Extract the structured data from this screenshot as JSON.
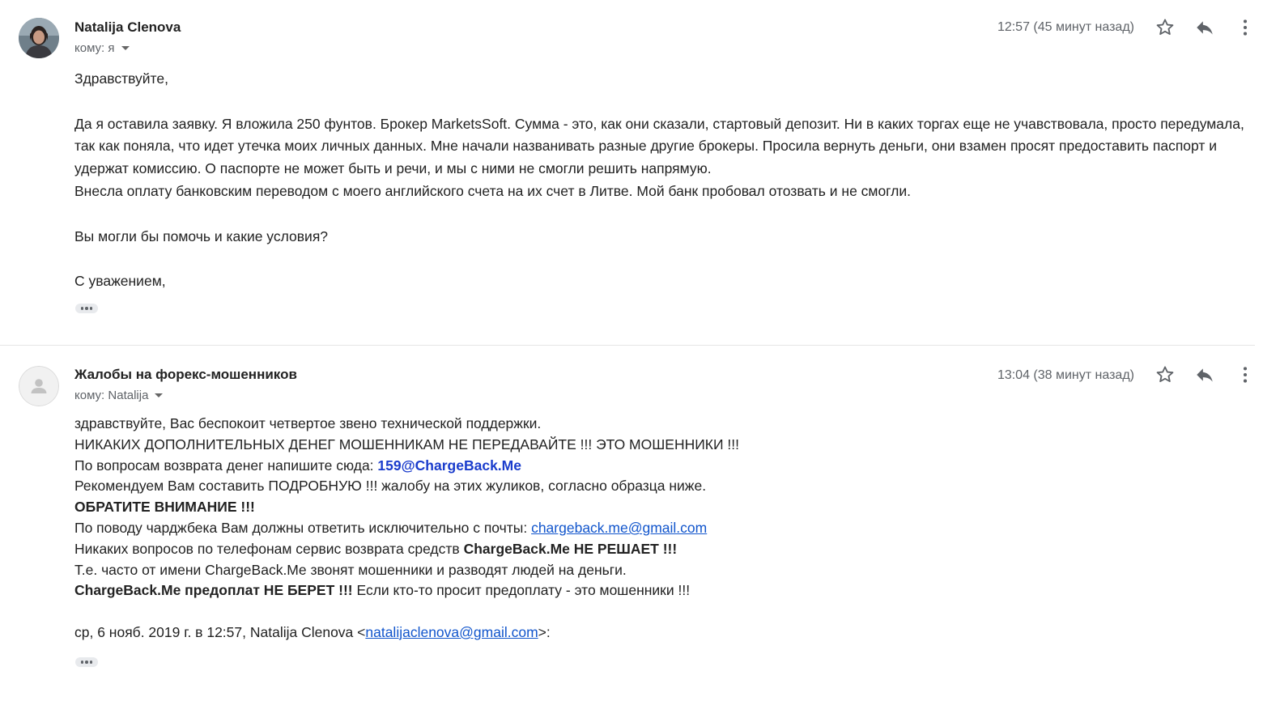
{
  "messages": [
    {
      "sender": "Natalija Clenova",
      "recipient": "кому: я",
      "time": "12:57 (45 минут назад)",
      "icons": {
        "star": "star-outline-icon",
        "reply": "reply-icon",
        "more": "more-vert-icon"
      },
      "body": {
        "greeting": "Здравствуйте,",
        "p1_l1": "Да я оставила заявку. Я вложила 250 фунтов. Брокер MarketsSoft. Сумма - это, как они сказали, стартовый депозит. Ни в каких торгах еще не учавствовала, просто передумала, так как поняла, что идет утечка моих личных данных. Мне начали названивать разные другие брокеры. Просила вернуть деньги, они взамен просят предоставить паспорт и удержат комиссию. О паспорте не может быть и речи, и мы с ними не смогли решить напрямую.",
        "p1_l2": "Внесла оплату банковским переводом с моего английского счета на их счет в Литве. Мой банк пробовал отозвать и не смогли.",
        "question": "Вы могли бы помочь и какие условия?",
        "closing": "С уважением,"
      }
    },
    {
      "sender": "Жалобы на форекс-мошенников",
      "recipient": "кому: Natalija",
      "time": "13:04 (38 минут назад)",
      "icons": {
        "star": "star-outline-icon",
        "reply": "reply-icon",
        "more": "more-vert-icon"
      },
      "body": {
        "l1": "здравствуйте, Вас беспокоит четвертое звено технической поддержки.",
        "l2": "НИКАКИХ ДОПОЛНИТЕЛЬНЫХ ДЕНЕГ МОШЕННИКАМ НЕ ПЕРЕДАВАЙТЕ !!! ЭТО МОШЕННИКИ !!!",
        "l3_prefix": "По вопросам возврата денег напишите сюда: ",
        "l3_email": "159@ChargeBack.Me",
        "l4": "Рекомендуем Вам составить ПОДРОБНУЮ !!! жалобу на этих жуликов, согласно образца ниже.",
        "l5": "ОБРАТИТЕ ВНИМАНИЕ !!!",
        "l6_prefix": "По поводу чарджбека Вам должны ответить исключительно с почты: ",
        "l6_link": "chargeback.me@gmail.com",
        "l7_prefix": "Никаких вопросов по телефонам сервис возврата средств ",
        "l7_bold": "ChargeBack.Me НЕ РЕШАЕТ !!!",
        "l8": "Т.е. часто от имени ChargeBack.Me звонят мошенники и разводят людей на деньги.",
        "l9_bold": "ChargeBack.Me предоплат НЕ БЕРЕТ !!!",
        "l9_rest": " Если кто-то просит предоплату - это мошенники !!!",
        "quote_prefix": "ср, 6 нояб. 2019 г. в 12:57, Natalija Clenova <",
        "quote_email": "natalijaclenova@gmail.com",
        "quote_suffix": ">:"
      }
    }
  ]
}
